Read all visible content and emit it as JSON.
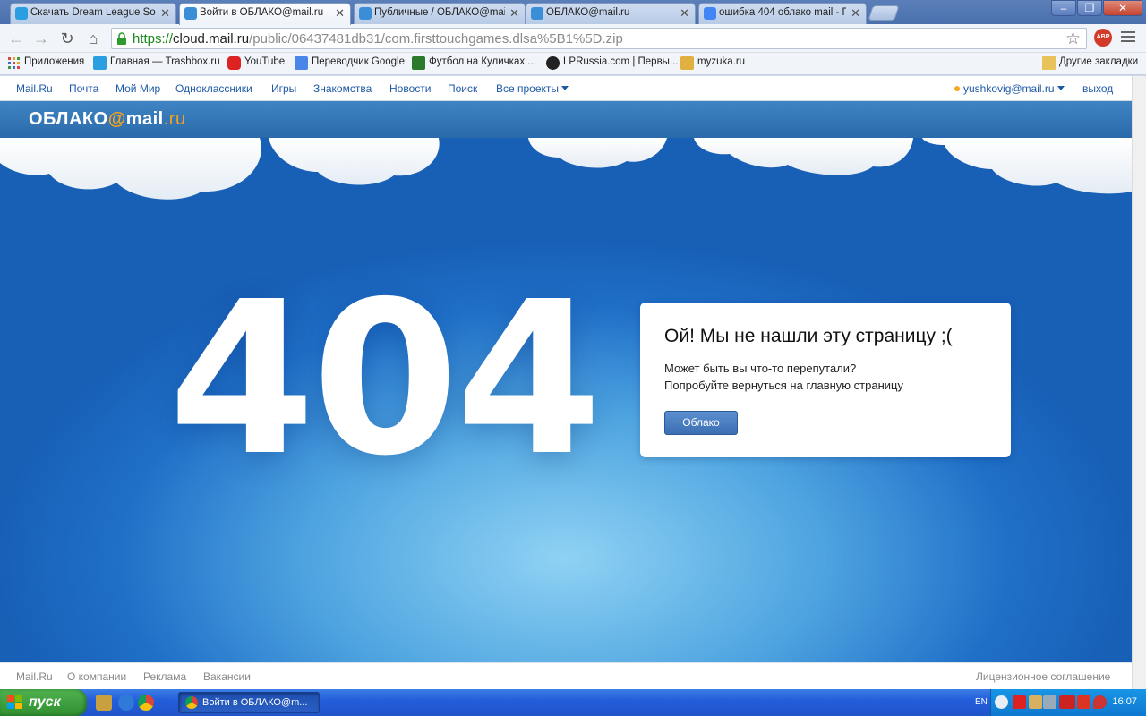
{
  "browser": {
    "tabs": [
      {
        "title": "Скачать Dream League Soc",
        "favicon_color": "#2a9ee0",
        "active": false
      },
      {
        "title": "Войти в ОБЛАКО@mail.ru",
        "favicon_color": "#3a8ed8",
        "active": true
      },
      {
        "title": "Публичные / ОБЛАКО@mail",
        "favicon_color": "#3a8ed8",
        "active": false
      },
      {
        "title": "ОБЛАКО@mail.ru",
        "favicon_color": "#3a8ed8",
        "active": false
      },
      {
        "title": "ошибка 404 облако mail - П",
        "favicon_color": "#4285f4",
        "active": false
      }
    ],
    "url": {
      "scheme": "https://",
      "host": "cloud.mail.ru",
      "path": "/public/06437481db31/com.firsttouchgames.dlsa%5B1%5D.zip"
    },
    "extension_badge": "ABP",
    "bookmarks": [
      {
        "label": "Приложения",
        "icon": "apps-grid-icon"
      },
      {
        "label": "Главная — Trashbox.ru",
        "icon": "trashbox-icon"
      },
      {
        "label": "YouTube",
        "icon": "youtube-icon"
      },
      {
        "label": "Переводчик Google",
        "icon": "translate-icon"
      },
      {
        "label": "Футбол на Куличках ...",
        "icon": "football-icon"
      },
      {
        "label": "LPRussia.com | Первы...",
        "icon": "lprussia-icon"
      },
      {
        "label": "myzuka.ru",
        "icon": "myzuka-icon"
      }
    ],
    "other_bookmarks": "Другие закладки"
  },
  "portal_nav": {
    "items": [
      "Mail.Ru",
      "Почта",
      "Мой Мир",
      "Одноклассники",
      "Игры",
      "Знакомства",
      "Новости",
      "Поиск",
      "Все проекты"
    ],
    "user": "yushkovig@mail.ru",
    "logout": "выход"
  },
  "cloud": {
    "logo_prefix": "ОБЛАКО",
    "logo_at": "@",
    "logo_mail": "mail",
    "logo_dot": ".",
    "logo_ru": "ru"
  },
  "error": {
    "code": "404",
    "title": "Ой! Мы не нашли эту страницу ;(",
    "line1": "Может быть вы что-то перепутали?",
    "line2": "Попробуйте вернуться на главную страницу",
    "button": "Облако"
  },
  "footer": {
    "left": [
      "Mail.Ru",
      "О компании",
      "Реклама",
      "Вакансии"
    ],
    "right": "Лицензионное соглашение"
  },
  "taskbar": {
    "start": "пуск",
    "active_window": "Войти в ОБЛАКО@m...",
    "lang": "EN",
    "time": "16:07"
  },
  "colors": {
    "accent_orange": "#f7a21d",
    "link_blue": "#1f5aa6",
    "button_blue": "#3b6fb3"
  }
}
